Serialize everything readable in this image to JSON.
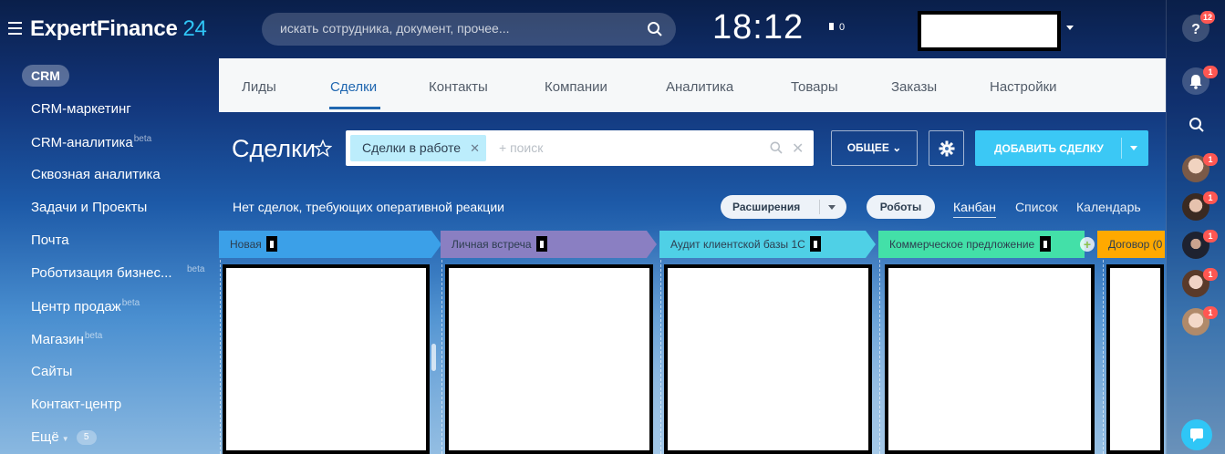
{
  "header": {
    "logo_main": "ExpertFinance",
    "logo_num": "24",
    "search_placeholder": "искать сотрудника, документ, прочее...",
    "clock": "18:12",
    "flag_count": "0"
  },
  "sidebar": {
    "crm_label": "CRM",
    "items": [
      {
        "label": "CRM-маркетинг",
        "sup": ""
      },
      {
        "label": "CRM-аналитика",
        "sup": "beta"
      },
      {
        "label": "Сквозная аналитика",
        "sup": ""
      },
      {
        "label": "Задачи и Проекты",
        "sup": ""
      },
      {
        "label": "Почта",
        "sup": ""
      },
      {
        "label": "Роботизация бизнес...",
        "sup": ""
      },
      {
        "label": "Центр продаж",
        "sup": "beta"
      },
      {
        "label": "Магазин",
        "sup": "beta"
      },
      {
        "label": "Сайты",
        "sup": ""
      },
      {
        "label": "Контакт-центр",
        "sup": ""
      }
    ],
    "robot_beta": "beta",
    "more_label": "Ещё",
    "more_count": "5"
  },
  "tabs": [
    "Лиды",
    "Сделки",
    "Контакты",
    "Компании",
    "Аналитика",
    "Товары",
    "Заказы",
    "Настройки"
  ],
  "toolbar": {
    "title": "Сделки",
    "filter_chip": "Сделки в работе",
    "filter_placeholder": "+ поиск",
    "general_label": "ОБЩЕЕ",
    "add_label": "ДОБАВИТЬ СДЕЛКУ"
  },
  "subbar": {
    "no_deals": "Нет сделок, требующих оперативной реакции",
    "extensions": "Расширения",
    "robots": "Роботы",
    "views": [
      "Канбан",
      "Список",
      "Календарь"
    ]
  },
  "kanban": {
    "columns": [
      {
        "name": "Новая",
        "color": "#3ba0e8"
      },
      {
        "name": "Личная встреча",
        "color": "#8a7fc2"
      },
      {
        "name": "Аудит клиентской базы 1С",
        "color": "#4fd0e6"
      },
      {
        "name": "Коммерческое предложение",
        "color": "#43e0a8"
      },
      {
        "name": "Договор (0",
        "color": "#ffa900"
      }
    ]
  },
  "rightbar": {
    "help_badge": "12",
    "notif_badge": "1",
    "avatar_badges": [
      "1",
      "1",
      "1",
      "1",
      "1"
    ]
  },
  "colors": {
    "accent": "#2fc6f6",
    "active_tab": "#2067b0",
    "badge": "#ff5752"
  }
}
